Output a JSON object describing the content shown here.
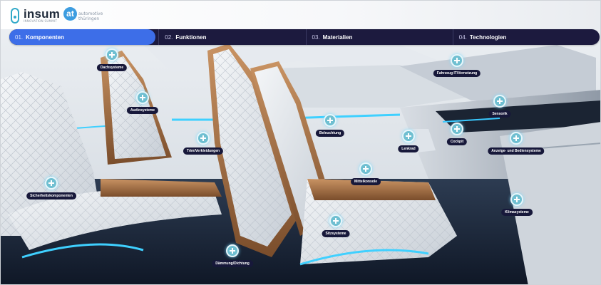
{
  "header": {
    "logo1": {
      "name": "insum",
      "tagline": "INNOVATION SUMMIT"
    },
    "logo2": {
      "mark": "at",
      "line1": "automotive",
      "line2": "thüringen"
    }
  },
  "nav": {
    "tabs": [
      {
        "num": "01.",
        "label": "Komponenten",
        "active": true
      },
      {
        "num": "02.",
        "label": "Funktionen",
        "active": false
      },
      {
        "num": "03.",
        "label": "Materialien",
        "active": false
      },
      {
        "num": "04.",
        "label": "Technologien",
        "active": false
      }
    ]
  },
  "hotspots": [
    {
      "label": "Dachsysteme"
    },
    {
      "label": "Fahrzeug IT/Vernetzung"
    },
    {
      "label": "Audiosysteme"
    },
    {
      "label": "Sensorik"
    },
    {
      "label": "Beleuchtung"
    },
    {
      "label": "Cockpit"
    },
    {
      "label": "Lenkrad"
    },
    {
      "label": "Trim/Verkleidungen"
    },
    {
      "label": "Anzeige- und Bediensysteme"
    },
    {
      "label": "Mittelkonsole"
    },
    {
      "label": "Sicherheitskomponenten"
    },
    {
      "label": "Klimasysteme"
    },
    {
      "label": "Sitzsysteme"
    },
    {
      "label": "Dämmung/Dichtung"
    }
  ]
}
